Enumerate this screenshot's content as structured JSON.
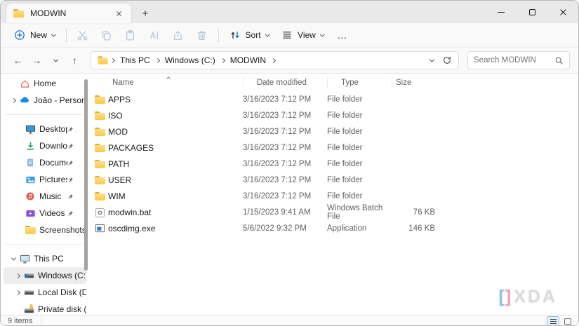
{
  "tab_bar": {
    "active_tab": "MODWIN",
    "new_tab_glyph": "+"
  },
  "toolbar": {
    "new": "New",
    "sort": "Sort",
    "view": "View",
    "more": "…",
    "disabled_icons": [
      "cut",
      "copy",
      "paste",
      "rename",
      "share",
      "delete"
    ]
  },
  "address_bar": {
    "breadcrumbs": [
      "This PC",
      "Windows (C:)",
      "MODWIN"
    ]
  },
  "search": {
    "placeholder": "Search MODWIN"
  },
  "sidebar": {
    "items": [
      {
        "label": "Home",
        "icon": "home-icon"
      },
      {
        "label": "João - Personal",
        "icon": "onedrive-icon",
        "expandable": true
      },
      {
        "label": "Desktop",
        "icon": "desktop-icon",
        "pinned": true
      },
      {
        "label": "Downloads",
        "icon": "downloads-icon",
        "pinned": true
      },
      {
        "label": "Documents",
        "icon": "documents-icon",
        "pinned": true
      },
      {
        "label": "Pictures",
        "icon": "pictures-icon",
        "pinned": true
      },
      {
        "label": "Music",
        "icon": "music-icon",
        "pinned": true
      },
      {
        "label": "Videos",
        "icon": "videos-icon",
        "pinned": true
      },
      {
        "label": "Screenshots",
        "icon": "folder-icon"
      },
      {
        "label": "This PC",
        "icon": "computer-icon",
        "expanded": true
      },
      {
        "label": "Windows (C:)",
        "icon": "windows-drive-icon",
        "selected": true
      },
      {
        "label": "Local Disk (D:)",
        "icon": "drive-icon",
        "expandable": true
      },
      {
        "label": "Private disk (S:",
        "icon": "locked-drive-icon",
        "clipped": true
      }
    ]
  },
  "file_list": {
    "columns": [
      "Name",
      "Date modified",
      "Type",
      "Size"
    ],
    "sort": {
      "column": "Name",
      "direction": "ascending"
    },
    "rows": [
      {
        "name": "APPS",
        "date_modified": "3/16/2023 7:12 PM",
        "type": "File folder",
        "size": "",
        "icon": "folder"
      },
      {
        "name": "ISO",
        "date_modified": "3/16/2023 7:12 PM",
        "type": "File folder",
        "size": "",
        "icon": "folder"
      },
      {
        "name": "MOD",
        "date_modified": "3/16/2023 7:12 PM",
        "type": "File folder",
        "size": "",
        "icon": "folder"
      },
      {
        "name": "PACKAGES",
        "date_modified": "3/16/2023 7:12 PM",
        "type": "File folder",
        "size": "",
        "icon": "folder"
      },
      {
        "name": "PATH",
        "date_modified": "3/16/2023 7:12 PM",
        "type": "File folder",
        "size": "",
        "icon": "folder"
      },
      {
        "name": "USER",
        "date_modified": "3/16/2023 7:12 PM",
        "type": "File folder",
        "size": "",
        "icon": "folder"
      },
      {
        "name": "WIM",
        "date_modified": "3/16/2023 7:12 PM",
        "type": "File folder",
        "size": "",
        "icon": "folder"
      },
      {
        "name": "modwin.bat",
        "date_modified": "1/15/2023 9:41 AM",
        "type": "Windows Batch File",
        "size": "76 KB",
        "icon": "batch-file"
      },
      {
        "name": "oscdimg.exe",
        "date_modified": "5/6/2022 9:32 PM",
        "type": "Application",
        "size": "146 KB",
        "icon": "application"
      }
    ]
  },
  "status_bar": {
    "items_count": "9 items"
  },
  "watermark": {
    "bracket_left": "[",
    "bracket_right": "]",
    "text": "XDA"
  },
  "colors": {
    "accent_blue": "#0a6ac4",
    "folder_yellow": "#fbc843",
    "disabled_icon": "#b9c6d4",
    "selection_bg": "#ededed",
    "onedrive_blue": "#1490df",
    "downloads_green": "#1d9e63",
    "music_red": "#e4584f",
    "videos_purple": "#8d4fd3",
    "watermark_blue": "#8fc3dd",
    "watermark_pink": "#f2a0b6"
  }
}
